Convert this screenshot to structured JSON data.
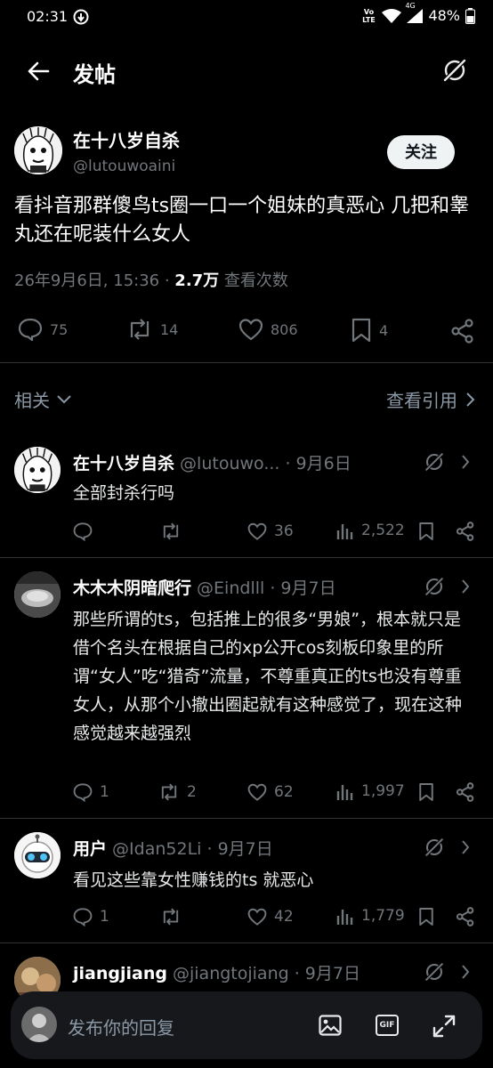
{
  "status_bar": {
    "time": "02:31",
    "volte": "Vo LTE",
    "network": "4G",
    "battery": "48%"
  },
  "header": {
    "title": "发帖"
  },
  "post": {
    "display_name": "在十八岁自杀",
    "handle": "@lutouwoaini",
    "follow_label": "关注",
    "text": "看抖音那群傻鸟ts圈一口一个姐妹的真恶心 几把和睾丸还在呢装什么女人",
    "date": "26年9月6日, 15:36 · ",
    "views_count": "2.7万",
    "views_label": " 查看次数",
    "replies": "75",
    "reposts": "14",
    "likes": "806",
    "bookmarks": "4"
  },
  "related_label": "相关",
  "quotes_label": "查看引用",
  "replies": [
    {
      "name": "在十八岁自杀",
      "handle_date": " @lutouwo... · 9月6日",
      "text": "全部封杀行吗",
      "replies": "",
      "reposts": "",
      "likes": "36",
      "views": "2,522"
    },
    {
      "name": "木木木阴暗爬行",
      "handle_date": " @Eindlll · 9月7日",
      "text": "那些所谓的ts，包括推上的很多“男娘”，根本就只是借个名头在根据自己的xp公开cos刻板印象里的所谓“女人”吃“猎奇”流量，不尊重真正的ts也没有尊重女人，从那个小撤出圈起就有这种感觉了，现在这种感觉越来越强烈",
      "replies": "1",
      "reposts": "2",
      "likes": "62",
      "views": "1,997"
    },
    {
      "name": "用户",
      "handle_date": " @Idan52Li · 9月7日",
      "text": "看见这些靠女性赚钱的ts 就恶心",
      "replies": "1",
      "reposts": "",
      "likes": "42",
      "views": "1,779"
    },
    {
      "name": "jiangjiang",
      "handle_date": " @jiangtojiang · 9月7日",
      "text": "",
      "replies": "",
      "reposts": "",
      "likes": "",
      "views": ""
    }
  ],
  "composer": {
    "placeholder": "发布你的回复",
    "gif_label": "GIF"
  },
  "colors": {
    "background": "#000000",
    "text": "#e7e9ea",
    "muted": "#71767b",
    "divider": "#2f3336"
  },
  "icons": [
    "back-arrow-icon",
    "grok-icon",
    "reply-icon",
    "repost-icon",
    "like-icon",
    "bookmark-icon",
    "share-icon",
    "views-icon",
    "image-icon",
    "gif-icon",
    "expand-icon"
  ]
}
